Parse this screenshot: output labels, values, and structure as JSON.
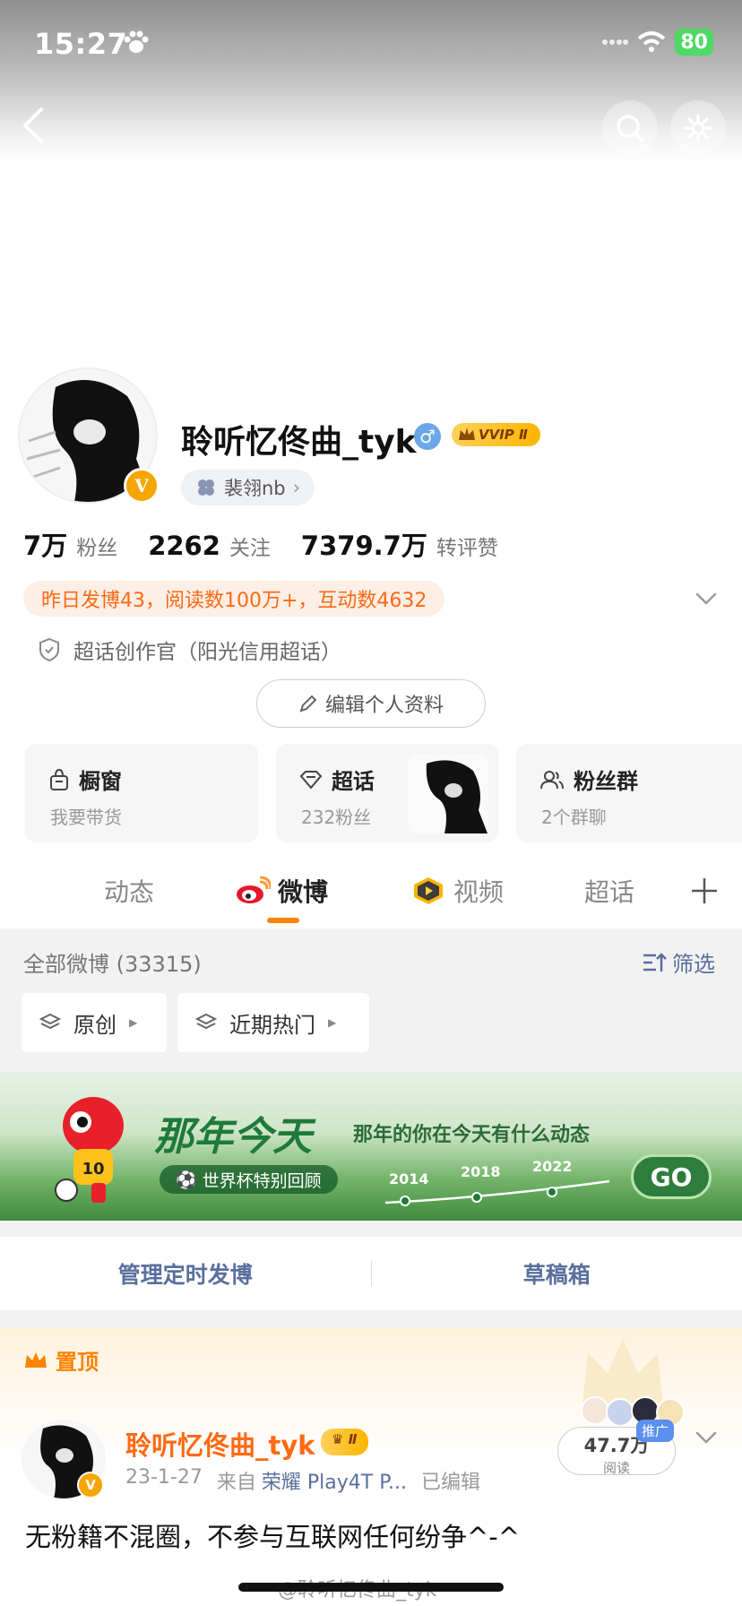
{
  "status_bar": {
    "time": "15:27",
    "battery": "80"
  },
  "profile": {
    "username": "聆听忆佟曲_tyk",
    "gender_symbol": "♂",
    "vip_label": "VVIP Ⅱ",
    "v_badge": "V",
    "tag": "裴翎nb",
    "stats": [
      {
        "num": "7万",
        "label": "粉丝"
      },
      {
        "num": "2262",
        "label": "关注"
      },
      {
        "num": "7379.7万",
        "label": "转评赞"
      }
    ],
    "activity": "昨日发博43，阅读数100万+，互动数4632",
    "creator": "超话创作官（阳光信用超话）",
    "edit_button": "编辑个人资料"
  },
  "cards": [
    {
      "title": "橱窗",
      "sub": "我要带货",
      "icon": "bag-icon"
    },
    {
      "title": "超话",
      "sub": "232粉丝",
      "icon": "diamond-icon"
    },
    {
      "title": "粉丝群",
      "sub": "2个群聊",
      "icon": "group-icon"
    }
  ],
  "tabs": [
    {
      "label": "动态"
    },
    {
      "label": "微博"
    },
    {
      "label": "视频"
    },
    {
      "label": "超话"
    }
  ],
  "feed": {
    "title": "全部微博 (33315)",
    "filter": "筛选",
    "chips": [
      "原创",
      "近期热门"
    ]
  },
  "banner": {
    "title": "那年今天",
    "subtitle": "那年的你在今天有什么动态",
    "pill": "世界杯特别回顾",
    "years": [
      "2014",
      "2018",
      "2022"
    ],
    "go": "GO"
  },
  "management": {
    "scheduled": "管理定时发博",
    "drafts": "草稿箱"
  },
  "pinned": {
    "label": "置顶",
    "author": "聆听忆佟曲_tyk",
    "vip": "Ⅱ",
    "date": "23-1-27",
    "source_prefix": "来自",
    "source": "荣耀 Play4T P...",
    "edited": "已编辑",
    "reads": "47.7万",
    "reads_label": "阅读",
    "promo": "推广",
    "text": "无粉籍不混圈，不参与互联网任何纷争^-^",
    "watermark": "@聆听忆佟曲_tyk"
  },
  "colors": {
    "accent": "#ff8200",
    "link": "#5a6f9e",
    "activity": "#ff6a13"
  }
}
